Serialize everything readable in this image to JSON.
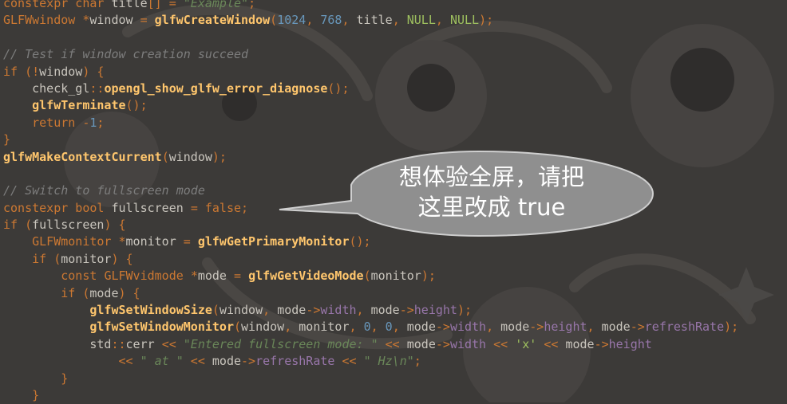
{
  "code_lines": [
    {
      "tokens": [
        {
          "c": "ty",
          "t": "constexpr char "
        },
        {
          "c": "pl",
          "t": "title"
        },
        {
          "c": "op",
          "t": "[] = "
        },
        {
          "c": "str",
          "t": "\"Example\""
        },
        {
          "c": "op",
          "t": ";"
        }
      ]
    },
    {
      "tokens": [
        {
          "c": "ty",
          "t": "GLFWwindow "
        },
        {
          "c": "op",
          "t": "*"
        },
        {
          "c": "pl",
          "t": "window "
        },
        {
          "c": "op",
          "t": "= "
        },
        {
          "c": "fn",
          "t": "glfwCreateWindow"
        },
        {
          "c": "op",
          "t": "("
        },
        {
          "c": "num",
          "t": "1024"
        },
        {
          "c": "op",
          "t": ", "
        },
        {
          "c": "num",
          "t": "768"
        },
        {
          "c": "op",
          "t": ", "
        },
        {
          "c": "pl",
          "t": "title"
        },
        {
          "c": "op",
          "t": ", "
        },
        {
          "c": "nul",
          "t": "NULL"
        },
        {
          "c": "op",
          "t": ", "
        },
        {
          "c": "nul",
          "t": "NULL"
        },
        {
          "c": "op",
          "t": ");"
        }
      ]
    },
    {
      "tokens": []
    },
    {
      "tokens": [
        {
          "c": "cmt",
          "t": "// Test if window creation succeed"
        }
      ]
    },
    {
      "tokens": [
        {
          "c": "kw",
          "t": "if "
        },
        {
          "c": "op",
          "t": "(!"
        },
        {
          "c": "pl",
          "t": "window"
        },
        {
          "c": "op",
          "t": ") {"
        }
      ]
    },
    {
      "tokens": [
        {
          "c": "pl",
          "t": "    check_gl"
        },
        {
          "c": "op",
          "t": "::"
        },
        {
          "c": "fn",
          "t": "opengl_show_glfw_error_diagnose"
        },
        {
          "c": "op",
          "t": "();"
        }
      ]
    },
    {
      "tokens": [
        {
          "c": "pl",
          "t": "    "
        },
        {
          "c": "fn",
          "t": "glfwTerminate"
        },
        {
          "c": "op",
          "t": "();"
        }
      ]
    },
    {
      "tokens": [
        {
          "c": "pl",
          "t": "    "
        },
        {
          "c": "kw",
          "t": "return "
        },
        {
          "c": "op",
          "t": "-"
        },
        {
          "c": "num",
          "t": "1"
        },
        {
          "c": "op",
          "t": ";"
        }
      ]
    },
    {
      "tokens": [
        {
          "c": "op",
          "t": "}"
        }
      ]
    },
    {
      "tokens": [
        {
          "c": "fn",
          "t": "glfwMakeContextCurrent"
        },
        {
          "c": "op",
          "t": "("
        },
        {
          "c": "pl",
          "t": "window"
        },
        {
          "c": "op",
          "t": ");"
        }
      ]
    },
    {
      "tokens": []
    },
    {
      "tokens": [
        {
          "c": "cmt",
          "t": "// Switch to fullscreen mode"
        }
      ]
    },
    {
      "tokens": [
        {
          "c": "ty",
          "t": "constexpr bool "
        },
        {
          "c": "pl",
          "t": "fullscreen "
        },
        {
          "c": "op",
          "t": "= "
        },
        {
          "c": "kw",
          "t": "false"
        },
        {
          "c": "op",
          "t": ";"
        }
      ]
    },
    {
      "tokens": [
        {
          "c": "kw",
          "t": "if "
        },
        {
          "c": "op",
          "t": "("
        },
        {
          "c": "pl",
          "t": "fullscreen"
        },
        {
          "c": "op",
          "t": ") {"
        }
      ]
    },
    {
      "tokens": [
        {
          "c": "pl",
          "t": "    "
        },
        {
          "c": "ty",
          "t": "GLFWmonitor "
        },
        {
          "c": "op",
          "t": "*"
        },
        {
          "c": "pl",
          "t": "monitor "
        },
        {
          "c": "op",
          "t": "= "
        },
        {
          "c": "fn",
          "t": "glfwGetPrimaryMonitor"
        },
        {
          "c": "op",
          "t": "();"
        }
      ]
    },
    {
      "tokens": [
        {
          "c": "pl",
          "t": "    "
        },
        {
          "c": "kw",
          "t": "if "
        },
        {
          "c": "op",
          "t": "("
        },
        {
          "c": "pl",
          "t": "monitor"
        },
        {
          "c": "op",
          "t": ") {"
        }
      ]
    },
    {
      "tokens": [
        {
          "c": "pl",
          "t": "        "
        },
        {
          "c": "kw",
          "t": "const "
        },
        {
          "c": "ty",
          "t": "GLFWvidmode "
        },
        {
          "c": "op",
          "t": "*"
        },
        {
          "c": "pl",
          "t": "mode "
        },
        {
          "c": "op",
          "t": "= "
        },
        {
          "c": "fn",
          "t": "glfwGetVideoMode"
        },
        {
          "c": "op",
          "t": "("
        },
        {
          "c": "pl",
          "t": "monitor"
        },
        {
          "c": "op",
          "t": ");"
        }
      ]
    },
    {
      "tokens": [
        {
          "c": "pl",
          "t": "        "
        },
        {
          "c": "kw",
          "t": "if "
        },
        {
          "c": "op",
          "t": "("
        },
        {
          "c": "pl",
          "t": "mode"
        },
        {
          "c": "op",
          "t": ") {"
        }
      ]
    },
    {
      "tokens": [
        {
          "c": "pl",
          "t": "            "
        },
        {
          "c": "fn",
          "t": "glfwSetWindowSize"
        },
        {
          "c": "op",
          "t": "("
        },
        {
          "c": "pl",
          "t": "window"
        },
        {
          "c": "op",
          "t": ", "
        },
        {
          "c": "pl",
          "t": "mode"
        },
        {
          "c": "op",
          "t": "->"
        },
        {
          "c": "mem",
          "t": "width"
        },
        {
          "c": "op",
          "t": ", "
        },
        {
          "c": "pl",
          "t": "mode"
        },
        {
          "c": "op",
          "t": "->"
        },
        {
          "c": "mem",
          "t": "height"
        },
        {
          "c": "op",
          "t": ");"
        }
      ]
    },
    {
      "tokens": [
        {
          "c": "pl",
          "t": "            "
        },
        {
          "c": "fn",
          "t": "glfwSetWindowMonitor"
        },
        {
          "c": "op",
          "t": "("
        },
        {
          "c": "pl",
          "t": "window"
        },
        {
          "c": "op",
          "t": ", "
        },
        {
          "c": "pl",
          "t": "monitor"
        },
        {
          "c": "op",
          "t": ", "
        },
        {
          "c": "num",
          "t": "0"
        },
        {
          "c": "op",
          "t": ", "
        },
        {
          "c": "num",
          "t": "0"
        },
        {
          "c": "op",
          "t": ", "
        },
        {
          "c": "pl",
          "t": "mode"
        },
        {
          "c": "op",
          "t": "->"
        },
        {
          "c": "mem",
          "t": "width"
        },
        {
          "c": "op",
          "t": ", "
        },
        {
          "c": "pl",
          "t": "mode"
        },
        {
          "c": "op",
          "t": "->"
        },
        {
          "c": "mem",
          "t": "height"
        },
        {
          "c": "op",
          "t": ", "
        },
        {
          "c": "pl",
          "t": "mode"
        },
        {
          "c": "op",
          "t": "->"
        },
        {
          "c": "mem",
          "t": "refreshRate"
        },
        {
          "c": "op",
          "t": ");"
        }
      ]
    },
    {
      "tokens": [
        {
          "c": "pl",
          "t": "            std"
        },
        {
          "c": "op",
          "t": "::"
        },
        {
          "c": "pl",
          "t": "cerr "
        },
        {
          "c": "op",
          "t": "<< "
        },
        {
          "c": "str",
          "t": "\"Entered fullscreen mode: \""
        },
        {
          "c": "op",
          "t": " << "
        },
        {
          "c": "pl",
          "t": "mode"
        },
        {
          "c": "op",
          "t": "->"
        },
        {
          "c": "mem",
          "t": "width "
        },
        {
          "c": "op",
          "t": "<< "
        },
        {
          "c": "nul",
          "t": "'x'"
        },
        {
          "c": "op",
          "t": " << "
        },
        {
          "c": "pl",
          "t": "mode"
        },
        {
          "c": "op",
          "t": "->"
        },
        {
          "c": "mem",
          "t": "height"
        }
      ]
    },
    {
      "tokens": [
        {
          "c": "pl",
          "t": "                "
        },
        {
          "c": "op",
          "t": "<< "
        },
        {
          "c": "str",
          "t": "\" at \""
        },
        {
          "c": "op",
          "t": " << "
        },
        {
          "c": "pl",
          "t": "mode"
        },
        {
          "c": "op",
          "t": "->"
        },
        {
          "c": "mem",
          "t": "refreshRate "
        },
        {
          "c": "op",
          "t": "<< "
        },
        {
          "c": "str",
          "t": "\" Hz\\n\""
        },
        {
          "c": "op",
          "t": ";"
        }
      ]
    },
    {
      "tokens": [
        {
          "c": "pl",
          "t": "        "
        },
        {
          "c": "op",
          "t": "}"
        }
      ]
    },
    {
      "tokens": [
        {
          "c": "pl",
          "t": "    "
        },
        {
          "c": "op",
          "t": "}"
        }
      ]
    }
  ],
  "callout": {
    "line1": "想体验全屏，请把",
    "line2": "这里改成 true"
  },
  "colors": {
    "background": "#3c3a38",
    "keyword": "#cc7832",
    "function": "#ffc66d",
    "string": "#6a8759",
    "comment": "#7d7d7d",
    "number": "#6897bb",
    "member": "#9876aa",
    "bubble": "#8f8f8f"
  }
}
